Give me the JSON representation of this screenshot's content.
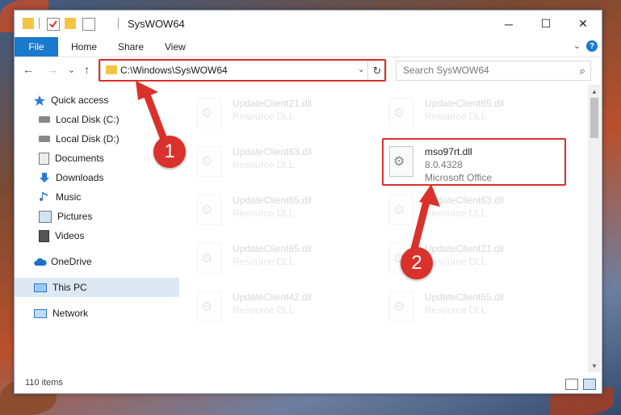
{
  "window": {
    "title": "SysWOW64",
    "minimize_glyph": "─",
    "maximize_glyph": "☐",
    "close_glyph": "✕"
  },
  "ribbon": {
    "tabs": [
      "File",
      "Home",
      "Share",
      "View"
    ],
    "expand_glyph": "⌄",
    "help_glyph": "?"
  },
  "navbar": {
    "back_glyph": "←",
    "forward_glyph": "→",
    "recent_glyph": "⌄",
    "up_glyph": "↑",
    "address": "C:\\Windows\\SysWOW64",
    "address_dropdown_glyph": "⌄",
    "refresh_glyph": "↻",
    "search_placeholder": "Search SysWOW64",
    "search_glyph": "⌕"
  },
  "sidebar": {
    "items": [
      {
        "label": "Quick access",
        "icon": "star-icon",
        "pinned": false
      },
      {
        "label": "Local Disk (C:)",
        "icon": "drive-icon",
        "pinned": true
      },
      {
        "label": "Local Disk (D:)",
        "icon": "drive-icon",
        "pinned": false
      },
      {
        "label": "Documents",
        "icon": "documents-icon",
        "pinned": true
      },
      {
        "label": "Downloads",
        "icon": "download-icon",
        "pinned": true
      },
      {
        "label": "Music",
        "icon": "music-icon",
        "pinned": true
      },
      {
        "label": "Pictures",
        "icon": "pictures-icon",
        "pinned": true
      },
      {
        "label": "Videos",
        "icon": "videos-icon",
        "pinned": true
      },
      {
        "label": "OneDrive",
        "icon": "cloud-icon",
        "pinned": false
      },
      {
        "label": "This PC",
        "icon": "computer-icon",
        "pinned": false
      },
      {
        "label": "Network",
        "icon": "network-icon",
        "pinned": false
      }
    ],
    "pin_glyph": "📌"
  },
  "files": [
    {
      "name": "UpdateClient21.dll",
      "type": "Resource DLL",
      "faded": true
    },
    {
      "name": "UpdateClient65.dll",
      "type": "Resource DLL",
      "faded": true
    },
    {
      "name": "UpdateClient63.dll",
      "type": "Resource DLL",
      "faded": true
    },
    {
      "name": "mso97rt.dll",
      "version": "8.0.4328",
      "company": "Microsoft Office",
      "faded": false
    },
    {
      "name": "UpdateClient65.dll",
      "type": "Resource DLL",
      "faded": true
    },
    {
      "name": "UpdateClient63.dll",
      "type": "Resource DLL",
      "faded": true
    },
    {
      "name": "UpdateClient65.dll",
      "type": "Resource DLL",
      "faded": true
    },
    {
      "name": "UpdateClient21.dll",
      "type": "Resource DLL",
      "faded": true
    },
    {
      "name": "UpdateClient42.dll",
      "type": "Resource DLL",
      "faded": true
    },
    {
      "name": "UpdateClient65.dll",
      "type": "Resource DLL",
      "faded": true
    }
  ],
  "status": {
    "item_count": "110 items"
  },
  "callouts": [
    "1",
    "2"
  ],
  "colors": {
    "accent": "#1979ca",
    "highlight": "#d9312b"
  }
}
